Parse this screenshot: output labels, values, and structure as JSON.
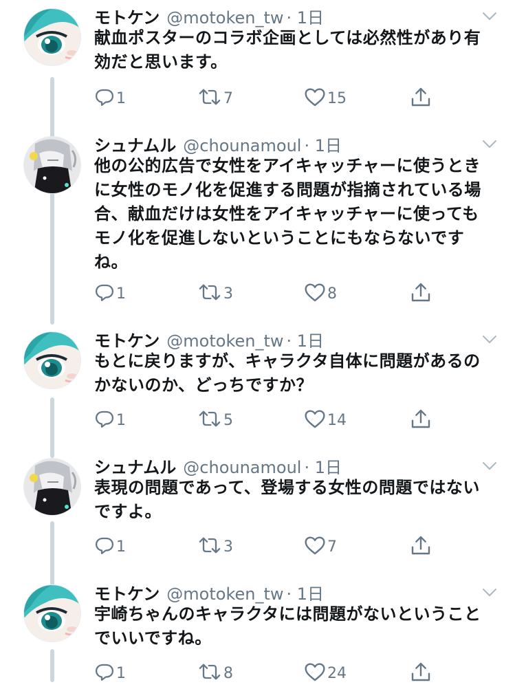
{
  "tweets": [
    {
      "name": "モトケン",
      "handle": "@motoken_tw",
      "time": "· 1日",
      "avatar": "motoken-avatar",
      "text": "献血ポスターのコラボ企画としては必然性があり有効だと思います。",
      "replies": "1",
      "retweets": "7",
      "likes": "15"
    },
    {
      "name": "シュナムル",
      "handle": "@chounamoul",
      "time": "· 1日",
      "avatar": "chounamoul-avatar",
      "text": "他の公的広告で女性をアイキャッチャーに使うときに女性のモノ化を促進する問題が指摘されている場合、献血だけは女性をアイキャッチャーに使ってもモノ化を促進しないということにもならないですね。",
      "replies": "1",
      "retweets": "3",
      "likes": "8"
    },
    {
      "name": "モトケン",
      "handle": "@motoken_tw",
      "time": "· 1日",
      "avatar": "motoken-avatar",
      "text": "もとに戻りますが、キャラクタ自体に問題があるのかないのか、どっちですか？",
      "replies": "1",
      "retweets": "5",
      "likes": "14"
    },
    {
      "name": "シュナムル",
      "handle": "@chounamoul",
      "time": "· 1日",
      "avatar": "chounamoul-avatar",
      "text": "表現の問題であって、登場する女性の問題ではないですよ。",
      "replies": "1",
      "retweets": "3",
      "likes": "7"
    },
    {
      "name": "モトケン",
      "handle": "@motoken_tw",
      "time": "· 1日",
      "avatar": "motoken-avatar",
      "text": "宇崎ちゃんのキャラクタには問題がないということでいいですね。",
      "replies": "1",
      "retweets": "8",
      "likes": "24"
    }
  ],
  "colors": {
    "text": "#14171a",
    "secondary": "#657786",
    "thread_line": "#ccd6dd"
  },
  "icons": {
    "reply": "reply-icon",
    "retweet": "retweet-icon",
    "like": "heart-icon",
    "share": "share-icon",
    "more": "chevron-down-icon"
  }
}
